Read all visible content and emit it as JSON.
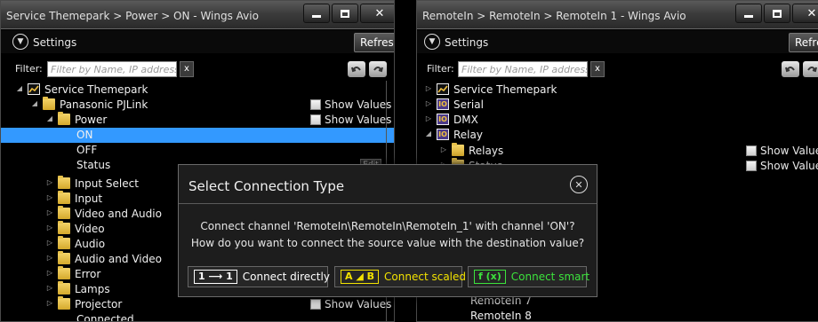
{
  "left_window": {
    "title": "Service Themepark > Power > ON - Wings Avio",
    "settings_label": "Settings",
    "refresh_label": "Refresh",
    "filter_label": "Filter:",
    "filter_placeholder": "Filter by Name, IP address or",
    "filter_clear": "x",
    "show_values_label": "Show Values",
    "tree": [
      {
        "label": "Service Themepark",
        "icon": "chart-icon",
        "level": 0,
        "expanded": true
      },
      {
        "label": "Panasonic PJLink",
        "icon": "folder-icon",
        "level": 1,
        "expanded": true,
        "show_values": true
      },
      {
        "label": "Power",
        "icon": "folder-icon",
        "level": 2,
        "expanded": true,
        "show_values": true
      },
      {
        "label": "ON",
        "level": 3,
        "selected": true
      },
      {
        "label": "OFF",
        "level": 3
      },
      {
        "label": "Status",
        "level": 3,
        "edit": "Edit"
      },
      {
        "label": "Input Select",
        "icon": "folder-icon",
        "level": 2
      },
      {
        "label": "Input",
        "icon": "folder-icon",
        "level": 2
      },
      {
        "label": "Video and Audio",
        "icon": "folder-icon",
        "level": 2
      },
      {
        "label": "Video",
        "icon": "folder-icon",
        "level": 2
      },
      {
        "label": "Audio",
        "icon": "folder-icon",
        "level": 2
      },
      {
        "label": "Audio and Video",
        "icon": "folder-icon",
        "level": 2
      },
      {
        "label": "Error",
        "icon": "folder-icon",
        "level": 2
      },
      {
        "label": "Lamps",
        "icon": "folder-icon",
        "level": 2
      },
      {
        "label": "Projector",
        "icon": "folder-icon",
        "level": 2,
        "show_values": true
      },
      {
        "label": "Connected",
        "level": 3
      }
    ]
  },
  "right_window": {
    "title": "RemoteIn > RemoteIn > RemoteIn 1 - Wings Avio",
    "settings_label": "Settings",
    "refresh_label": "Refresh",
    "filter_label": "Filter:",
    "filter_placeholder": "Filter by Name, IP address or",
    "filter_clear": "x",
    "show_values_label": "Show Values",
    "tree": [
      {
        "label": "Service Themepark",
        "icon": "chart-icon",
        "level": 0
      },
      {
        "label": "Serial",
        "icon": "io-icon",
        "level": 0
      },
      {
        "label": "DMX",
        "icon": "io-icon",
        "level": 0
      },
      {
        "label": "Relay",
        "icon": "io-icon",
        "level": 0,
        "expanded": true
      },
      {
        "label": "Relays",
        "icon": "folder-icon",
        "level": 1,
        "show_values": true
      },
      {
        "label": "Status",
        "icon": "folder-icon",
        "level": 1,
        "show_values": true
      },
      {
        "label": "RemoteIn 7",
        "level": 2
      },
      {
        "label": "RemoteIn 8",
        "level": 2
      }
    ],
    "io_glyph": "IO"
  },
  "dialog": {
    "title": "Select Connection Type",
    "message_line1": "Connect channel 'RemoteIn\\RemoteIn\\RemoteIn_1' with channel 'ON'?",
    "message_line2": "How do you want to connect the source value with the destination value?",
    "buttons": [
      {
        "badge": "1 ⟶ 1",
        "label": "Connect directly",
        "color": "#ffffff"
      },
      {
        "badge": "A ◢ B",
        "label": "Connect scaled",
        "color": "#f2e200"
      },
      {
        "badge": "f (x)",
        "label": "Connect smart",
        "color": "#3ce23c"
      }
    ]
  },
  "colors": {
    "selection": "#3399ff",
    "folder": "#e8c14a"
  }
}
